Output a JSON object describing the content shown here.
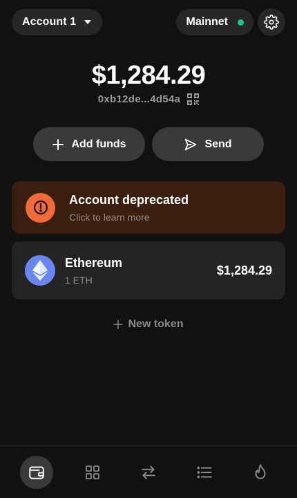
{
  "header": {
    "account_label": "Account 1",
    "network_label": "Mainnet",
    "network_status_color": "#1bc68a"
  },
  "wallet": {
    "balance": "$1,284.29",
    "address": "0xb12de...4d54a"
  },
  "actions": {
    "add_funds_label": "Add funds",
    "send_label": "Send"
  },
  "warning": {
    "title": "Account deprecated",
    "subtitle": "Click to learn more",
    "accent_color": "#f06b38"
  },
  "tokens": [
    {
      "name": "Ethereum",
      "amount": "1 ETH",
      "value": "$1,284.29",
      "icon": "ethereum-icon"
    }
  ],
  "new_token_label": "New token",
  "nav": {
    "items": [
      {
        "icon": "wallet-icon",
        "active": true
      },
      {
        "icon": "apps-grid-icon",
        "active": false
      },
      {
        "icon": "swap-arrows-icon",
        "active": false
      },
      {
        "icon": "list-icon",
        "active": false
      },
      {
        "icon": "flame-icon",
        "active": false
      }
    ]
  }
}
